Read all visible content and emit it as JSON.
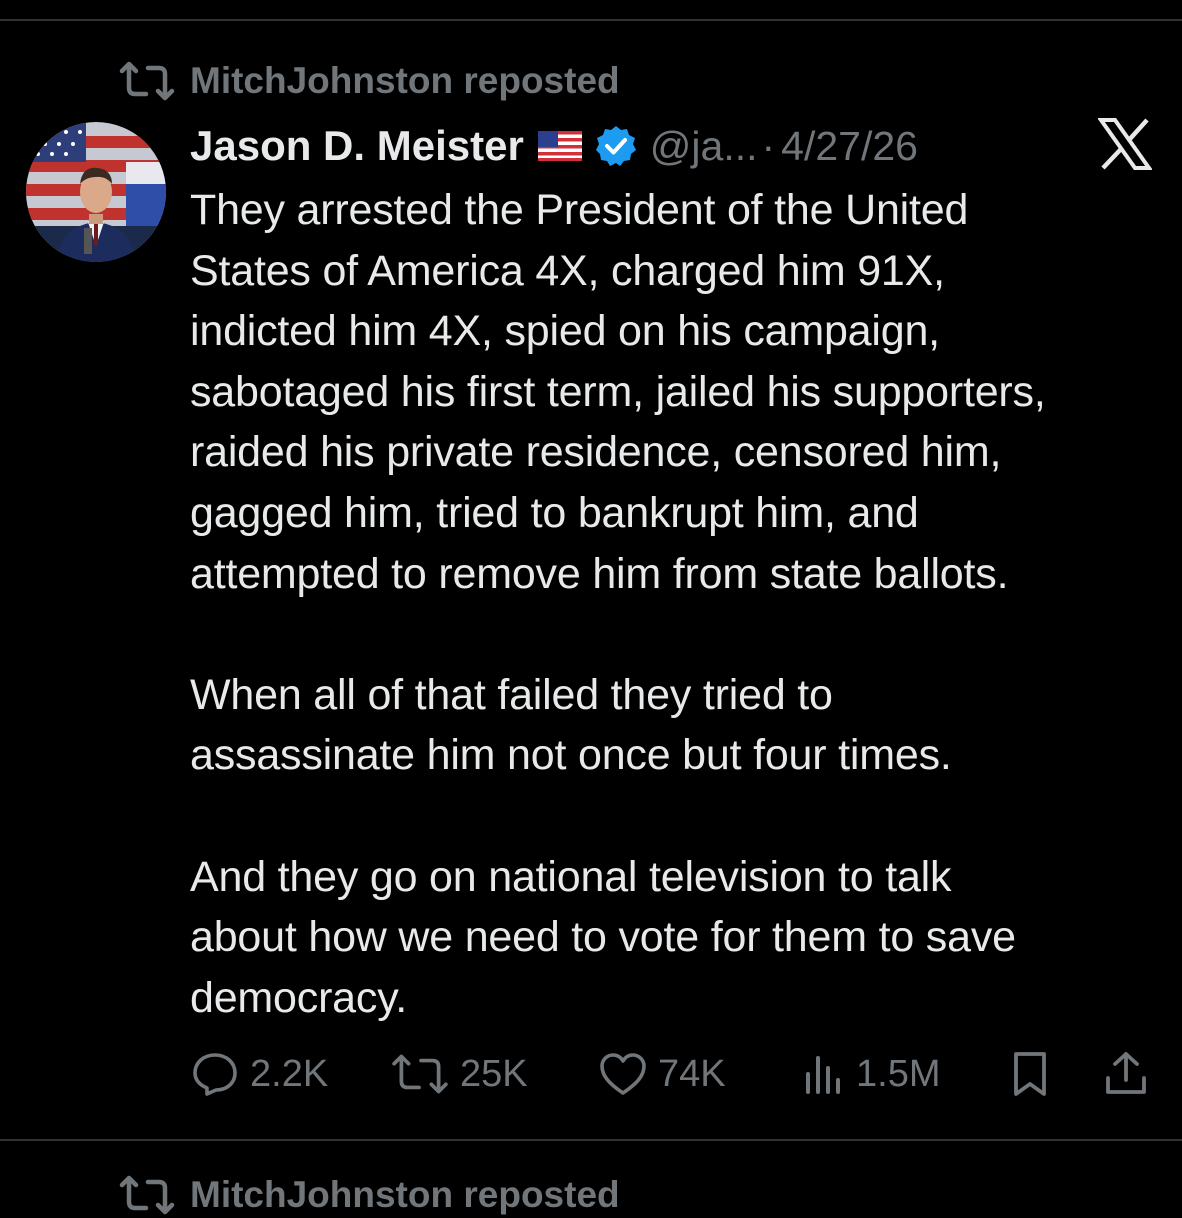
{
  "repost": {
    "label": "MitchJohnston reposted",
    "next_label": "MitchJohnston reposted"
  },
  "author": {
    "name": "Jason D. Meister",
    "flag_icon": "us-flag-icon",
    "verified_icon": "verified-badge-icon",
    "handle": "@ja...",
    "separator": "·",
    "date": "4/27/26"
  },
  "tweet": {
    "paragraphs": [
      "They arrested the President of the United\nStates of America 4X, charged him 91X,\nindicted him 4X, spied on his campaign,\nsabotaged his first term, jailed his supporters,\nraided his private residence, censored him,\ngagged him, tried to bankrupt him, and\nattempted to remove him from state ballots.",
      "When all of that failed they tried to\nassassinate him not once but four times.",
      "And they go on national television to talk\nabout how we need to vote for them to save\ndemocracy."
    ]
  },
  "actions": {
    "replies": "2.2K",
    "reposts": "25K",
    "likes": "74K",
    "views": "1.5M"
  },
  "colors": {
    "background": "#000000",
    "text": "#e7e9ea",
    "muted": "#71767b",
    "verified": "#1d9bf0",
    "divider": "#2f3336"
  }
}
